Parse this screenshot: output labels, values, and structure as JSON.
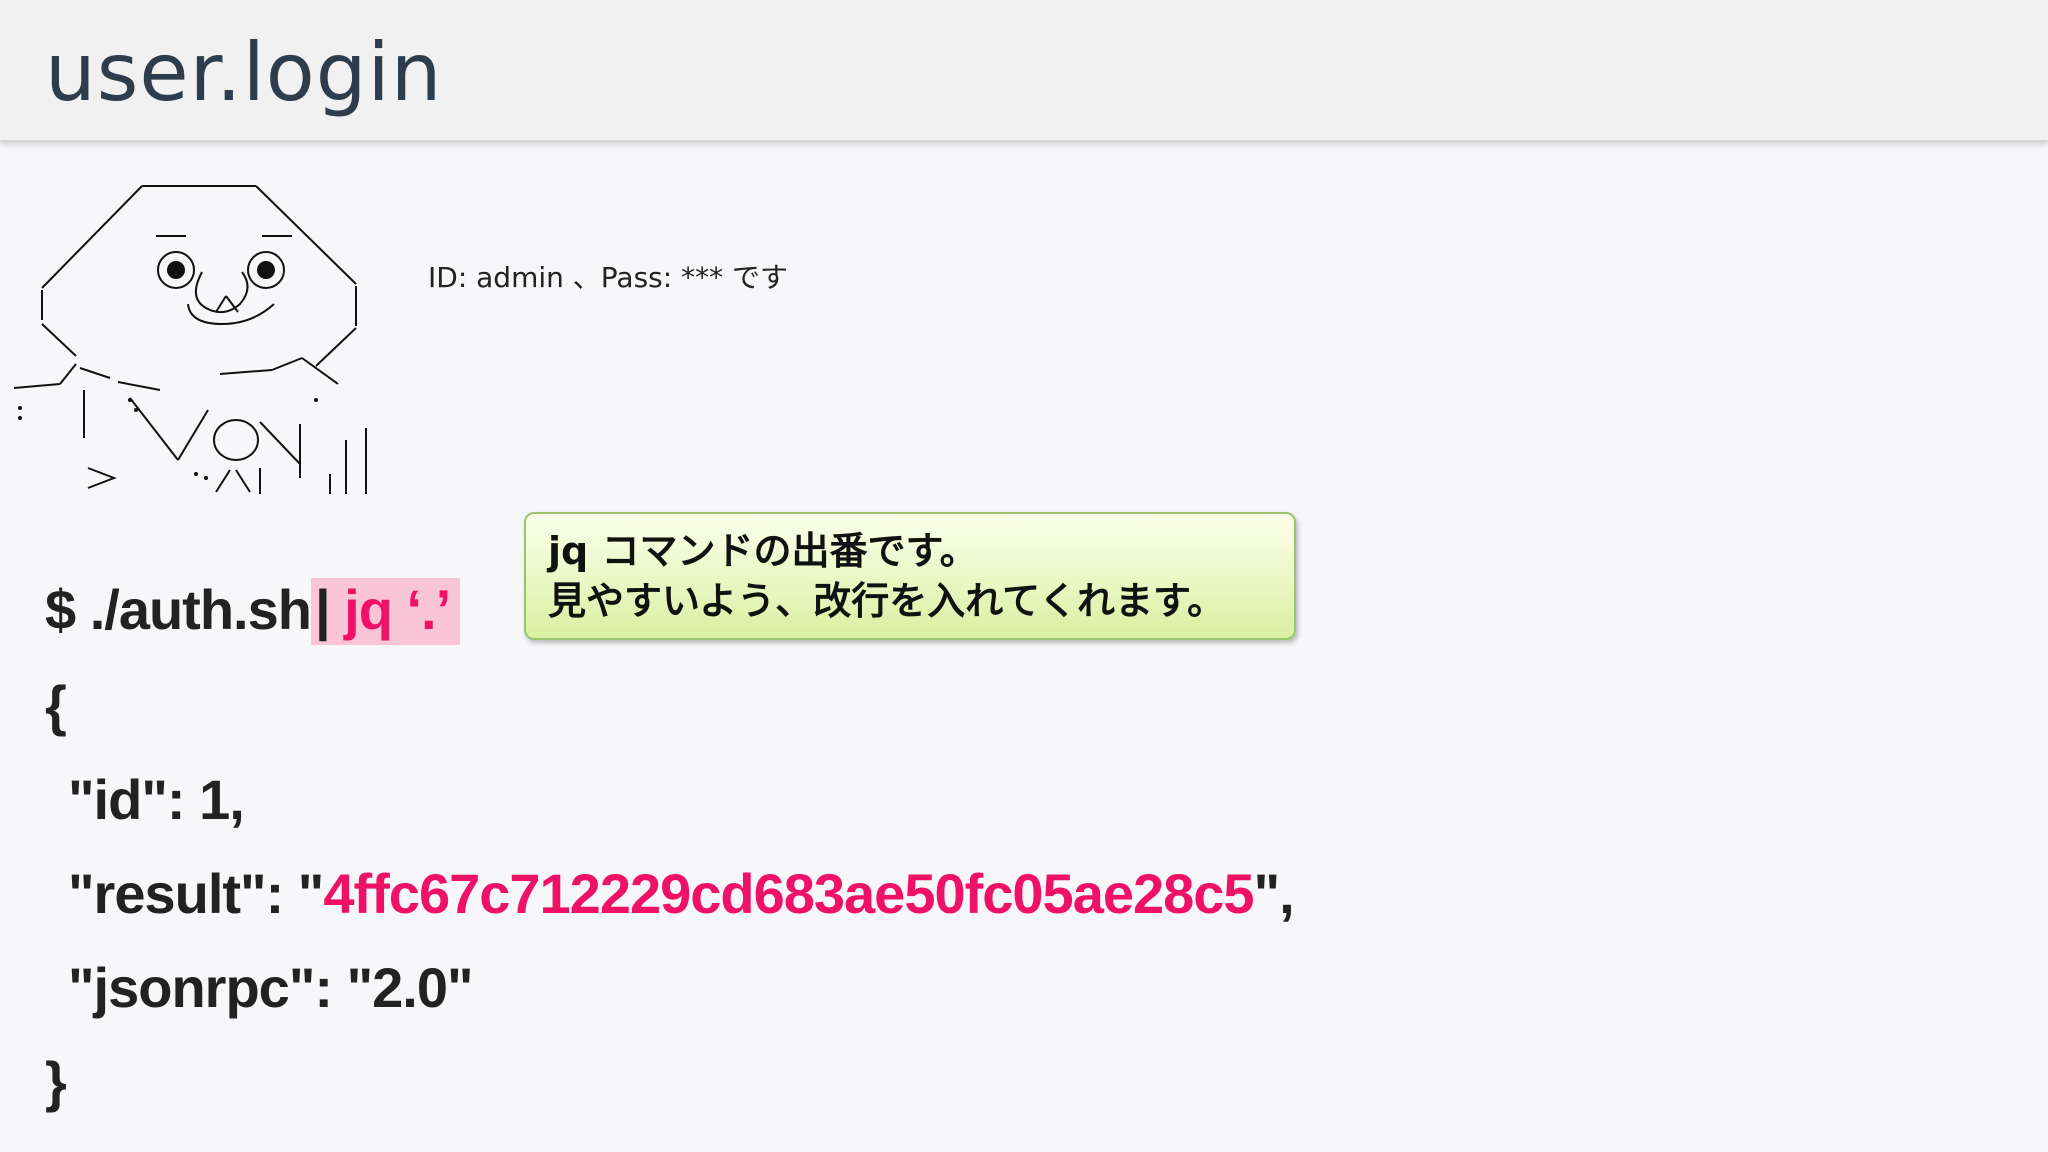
{
  "header": {
    "title": "user.login"
  },
  "aa_caption": "ID: admin 、Pass: *** です",
  "callout": {
    "line1": "jq コマンドの出番です。",
    "line2": "見やすいよう、改行を入れてくれます。"
  },
  "command": {
    "prompt": "$ ./auth.sh",
    "pipe": "|",
    "jq": " jq ‘.’"
  },
  "json_output": {
    "open_brace": "{",
    "id_key": "\"id\": ",
    "id_value": "1,",
    "result_key": "\"result\": \"",
    "result_value": "4ffc67c712229cd683ae50fc05ae28c5",
    "result_end": "\",",
    "jsonrpc_key": "\"jsonrpc\": ",
    "jsonrpc_value": "\"2.0\"",
    "close_brace": "}"
  },
  "colors": {
    "accent_pink": "#ee1166",
    "highlight_pink": "#f9c4d6",
    "title_color": "#2e3d4d"
  },
  "icons": {
    "ascii_art": "ascii-art-character-icon"
  }
}
